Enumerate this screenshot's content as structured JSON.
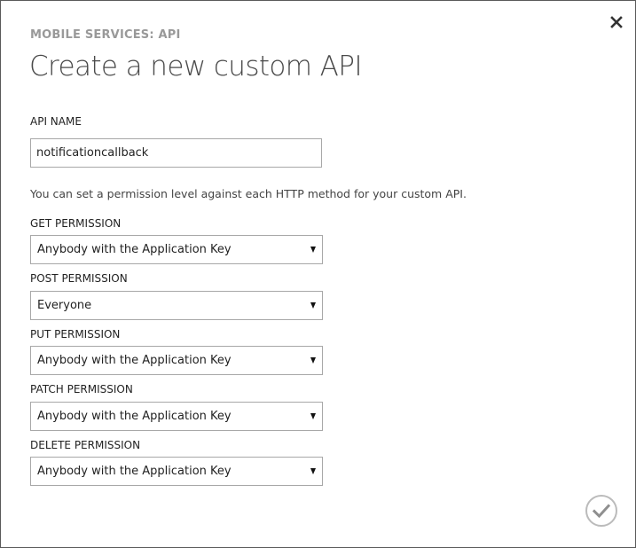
{
  "dialog": {
    "subtitle": "MOBILE SERVICES: API",
    "title": "Create a new custom API",
    "api_name_label": "API NAME",
    "api_name_value": "notificationcallback",
    "description": "You can set a permission level against each HTTP method for your custom API.",
    "permissions": [
      {
        "label": "GET PERMISSION",
        "value": "Anybody with the Application Key"
      },
      {
        "label": "POST PERMISSION",
        "value": "Everyone"
      },
      {
        "label": "PUT PERMISSION",
        "value": "Anybody with the Application Key"
      },
      {
        "label": "PATCH PERMISSION",
        "value": "Anybody with the Application Key"
      },
      {
        "label": "DELETE PERMISSION",
        "value": "Anybody with the Application Key"
      }
    ]
  },
  "icons": {
    "close": "close-icon",
    "confirm": "checkmark-icon",
    "dropdown": "chevron-down-icon"
  },
  "colors": {
    "border": "#a8a8a8",
    "subtitle": "#999999",
    "confirm_circle": "#bbbbbb"
  }
}
